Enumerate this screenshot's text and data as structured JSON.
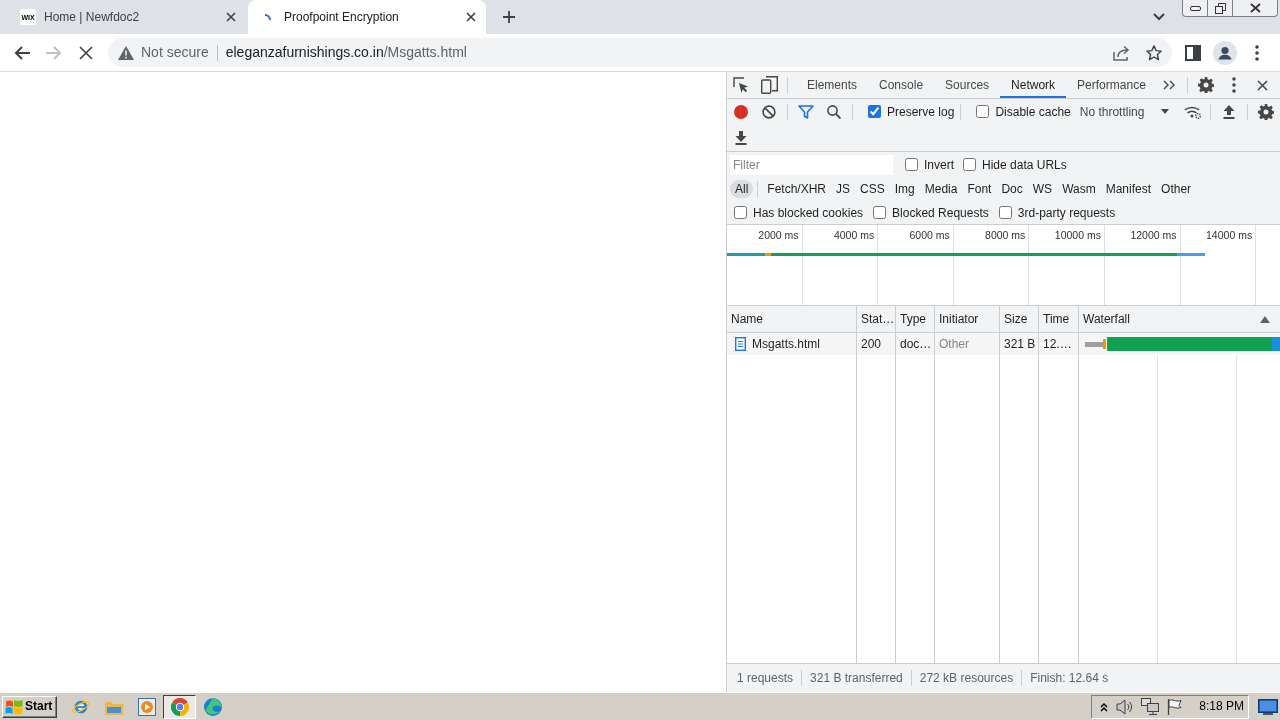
{
  "browser": {
    "tabs": [
      {
        "title": "Home | Newfdoc2",
        "favicon_text": "WIX",
        "loading": false,
        "selected": false
      },
      {
        "title": "Proofpoint Encryption",
        "loading": true,
        "selected": true
      }
    ],
    "forward": {
      "disabled": true
    },
    "loading": true,
    "address": {
      "security": "Not secure",
      "host": "eleganzafurnishings.co.in",
      "path": "/Msgatts.html"
    }
  },
  "devtools": {
    "tabs": [
      {
        "label": "Elements",
        "selected": false
      },
      {
        "label": "Console",
        "selected": false
      },
      {
        "label": "Sources",
        "selected": false
      },
      {
        "label": "Network",
        "selected": true
      },
      {
        "label": "Performance",
        "selected": false
      }
    ],
    "recording": true,
    "toolbar_checks": [
      {
        "label": "Preserve log",
        "checked": true
      },
      {
        "label": "Disable cache",
        "checked": false
      }
    ],
    "throttling": "No throttling",
    "filter": {
      "placeholder": "Filter"
    },
    "filter_checks": [
      {
        "label": "Invert",
        "checked": false
      },
      {
        "label": "Hide data URLs",
        "checked": false
      }
    ],
    "type_filters": [
      {
        "label": "All",
        "selected": true
      },
      {
        "label": "Fetch/XHR",
        "selected": false
      },
      {
        "label": "JS",
        "selected": false
      },
      {
        "label": "CSS",
        "selected": false
      },
      {
        "label": "Img",
        "selected": false
      },
      {
        "label": "Media",
        "selected": false
      },
      {
        "label": "Font",
        "selected": false
      },
      {
        "label": "Doc",
        "selected": false
      },
      {
        "label": "WS",
        "selected": false
      },
      {
        "label": "Wasm",
        "selected": false
      },
      {
        "label": "Manifest",
        "selected": false
      },
      {
        "label": "Other",
        "selected": false
      }
    ],
    "request_filters": [
      {
        "label": "Has blocked cookies",
        "checked": false
      },
      {
        "label": "Blocked Requests",
        "checked": false
      },
      {
        "label": "3rd-party requests",
        "checked": false
      }
    ],
    "overview": {
      "ticks": [
        "2000 ms",
        "4000 ms",
        "6000 ms",
        "8000 ms",
        "10000 ms",
        "12000 ms",
        "14000 ms"
      ]
    },
    "table": {
      "columns": [
        {
          "label": "Name",
          "sorted": false
        },
        {
          "label": "Stat…",
          "sorted": false
        },
        {
          "label": "Type",
          "sorted": false
        },
        {
          "label": "Initiator",
          "sorted": false
        },
        {
          "label": "Size",
          "sorted": false
        },
        {
          "label": "Time",
          "sorted": false
        },
        {
          "label": "Waterfall",
          "sorted": true
        }
      ],
      "rows": [
        {
          "name": "Msgatts.html",
          "status": "200",
          "type": "doc…",
          "initiator": "Other",
          "size": "321 B",
          "time": "12.…"
        }
      ]
    },
    "status_bar": [
      "1 requests",
      "321 B transferred",
      "272 kB resources",
      "Finish: 12.64 s"
    ]
  },
  "taskbar": {
    "start": "Start",
    "apps": [
      {
        "selected": false
      },
      {
        "selected": false
      },
      {
        "selected": false
      },
      {
        "selected": true
      },
      {
        "selected": false
      }
    ],
    "clock": "8:18 PM"
  }
}
